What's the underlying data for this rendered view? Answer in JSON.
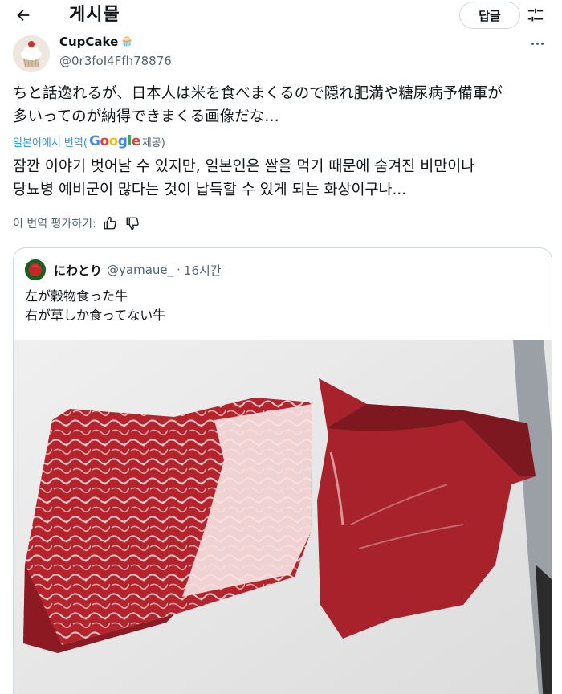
{
  "header": {
    "title": "게시물",
    "reply_label": "답글",
    "back_icon": "back-arrow-icon",
    "settings_icon": "sliders-icon"
  },
  "author": {
    "name": "CupCake",
    "name_emoji": "🧁",
    "handle": "@0r3foI4Ffh78876"
  },
  "post": {
    "text_line1": "ちと話逸れるが、日本人は米を食べまくるので隠れ肥満や糖尿病予備軍が",
    "text_line2": "多いってのが納得できまくる画像だな…",
    "translated_prefix": "일본어에서 번역(",
    "translated_provider": "Google",
    "translated_suffix": " 제공)",
    "translation_line1": "잠깐 이야기 벗어날 수 있지만, 일본인은 쌀을 먹기 때문에 숨겨진 비만이나",
    "translation_line2": "당뇨병 예비군이 많다는 것이 납득할 수 있게 되는 화상이구나...",
    "rate_label": "이 번역 평가하기:"
  },
  "quote": {
    "name": "にわとり",
    "handle": "@yamaue_",
    "separator": "·",
    "time": "16시간",
    "text_line1": "左が穀物食った牛",
    "text_line2": "右が草しか食ってない牛"
  },
  "colors": {
    "link": "#1d9bf0",
    "secondary_text": "#536471",
    "border": "#cfd9de"
  }
}
